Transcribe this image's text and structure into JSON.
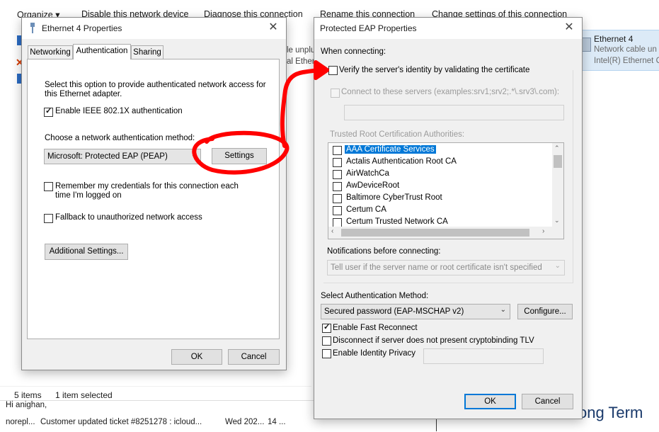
{
  "explorer": {
    "toolbar": [
      "Organize ▾",
      "Disable this network device",
      "Diagnose this connection",
      "Rename this connection",
      "Change settings of this connection"
    ],
    "adapter": {
      "name": "Ethernet 4",
      "status": "Network cable un",
      "device": "Intel(R) Ethernet C"
    },
    "partial_behind": [
      "le unplu",
      "al Ether"
    ],
    "status_bar": {
      "items": "5 items",
      "selected": "1 item selected"
    },
    "mail": {
      "greeting": "Hi anighan,",
      "row_from": "norepl...",
      "row_subject": "Customer updated ticket #8251278 : icloud...",
      "row_date": "Wed 202...",
      "row_size": "14 ..."
    },
    "watermark": "ong Term"
  },
  "ethernet_dialog": {
    "title": "Ethernet 4 Properties",
    "tabs": [
      "Networking",
      "Authentication",
      "Sharing"
    ],
    "active_tab": "Authentication",
    "description_line1": "Select this option to provide authenticated network access for",
    "description_line2": "this Ethernet adapter.",
    "enable_8021x": {
      "label": "Enable IEEE 802.1X authentication",
      "checked": true
    },
    "method_label": "Choose a network authentication method:",
    "method_value": "Microsoft: Protected EAP (PEAP)",
    "settings_button": "Settings",
    "remember_line1": "Remember my credentials for this connection each",
    "remember_line2": "time I'm logged on",
    "remember_checked": false,
    "fallback_label": "Fallback to unauthorized network access",
    "fallback_checked": false,
    "additional_button": "Additional Settings...",
    "ok_button": "OK",
    "cancel_button": "Cancel"
  },
  "peap_dialog": {
    "title": "Protected EAP Properties",
    "when_connecting": "When connecting:",
    "verify": {
      "label": "Verify the server's identity by validating the certificate",
      "checked": false
    },
    "connect_servers": {
      "label": "Connect to these servers (examples:srv1;srv2;.*\\.srv3\\.com):",
      "checked": false,
      "value": ""
    },
    "trusted_label": "Trusted Root Certification Authorities:",
    "certificates": [
      {
        "name": "AAA Certificate Services",
        "checked": false,
        "selected": true
      },
      {
        "name": "Actalis Authentication Root CA",
        "checked": false,
        "selected": false
      },
      {
        "name": "AirWatchCa",
        "checked": false,
        "selected": false
      },
      {
        "name": "AwDeviceRoot",
        "checked": false,
        "selected": false
      },
      {
        "name": "Baltimore CyberTrust Root",
        "checked": false,
        "selected": false
      },
      {
        "name": "Certum CA",
        "checked": false,
        "selected": false
      },
      {
        "name": "Certum Trusted Network CA",
        "checked": false,
        "selected": false
      }
    ],
    "notifications_label": "Notifications before connecting:",
    "notifications_value": "Tell user if the server name or root certificate isn't specified",
    "auth_method_label": "Select Authentication Method:",
    "auth_method_value": "Secured password (EAP-MSCHAP v2)",
    "configure_button": "Configure...",
    "fast_reconnect": {
      "label": "Enable Fast Reconnect",
      "checked": true
    },
    "disconnect_tlv": {
      "label": "Disconnect if server does not present cryptobinding TLV",
      "checked": false
    },
    "identity_privacy": {
      "label": "Enable Identity Privacy",
      "checked": false,
      "value": ""
    },
    "ok_button": "OK",
    "cancel_button": "Cancel"
  },
  "annotation": {
    "color": "#ff0000"
  }
}
